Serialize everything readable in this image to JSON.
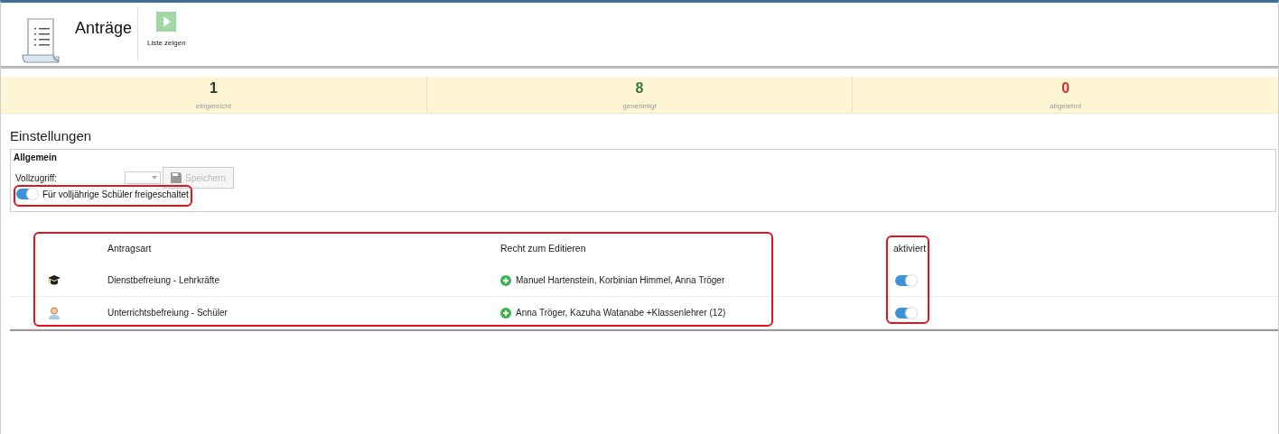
{
  "header": {
    "title": "Anträge",
    "actions": [
      {
        "label": "Liste zeigen"
      }
    ]
  },
  "stats": [
    {
      "value": "1",
      "label": "eingereicht",
      "color": "#333333"
    },
    {
      "value": "8",
      "label": "genehmigt",
      "color": "#3c7a3c"
    },
    {
      "value": "0",
      "label": "abgelehnt",
      "color": "#d9302c"
    }
  ],
  "settings": {
    "title": "Einstellungen",
    "group": "Allgemein",
    "full_access_label": "Vollzugriff:",
    "save_button": {
      "label": "Speichern",
      "disabled": true
    },
    "adult_toggle": {
      "label": "Für volljährige Schüler freigeschaltet",
      "on": true
    }
  },
  "table": {
    "columns": [
      "Antragsart",
      "Recht zum Editieren",
      "aktiviert"
    ],
    "rows": [
      {
        "kind": "teacher",
        "type": "Dienstbefreiung - Lehrkräfte",
        "editors": "Manuel Hartenstein, Korbinian Himmel, Anna Tröger",
        "enabled": true
      },
      {
        "kind": "student",
        "type": "Unterrichtsbefreiung - Schüler",
        "editors": "Anna Tröger, Kazuha Watanabe +Klassenlehrer (12)",
        "enabled": true
      }
    ]
  }
}
